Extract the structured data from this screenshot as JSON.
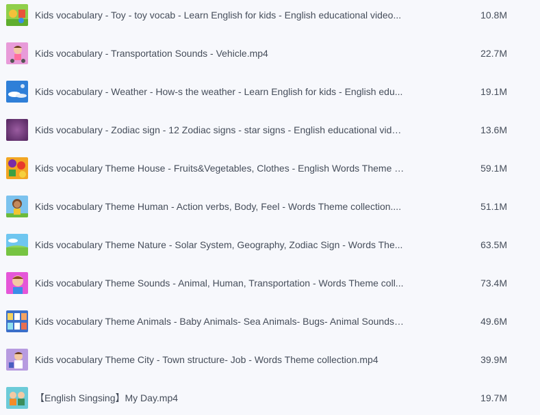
{
  "files": [
    {
      "name": "Kids vocabulary - Toy - toy vocab - Learn English for kids - English educational video...",
      "size": "10.8M",
      "thumb": "toy-thumbnail-icon"
    },
    {
      "name": "Kids vocabulary - Transportation Sounds - Vehicle.mp4",
      "size": "22.7M",
      "thumb": "transportation-thumbnail-icon"
    },
    {
      "name": "Kids vocabulary - Weather - How-s the weather - Learn English for kids - English edu...",
      "size": "19.1M",
      "thumb": "weather-thumbnail-icon"
    },
    {
      "name": "Kids vocabulary - Zodiac sign - 12 Zodiac signs - star signs - English educational vide...",
      "size": "13.6M",
      "thumb": "zodiac-thumbnail-icon"
    },
    {
      "name": "Kids vocabulary Theme House - Fruits&Vegetables, Clothes - English Words Theme c...",
      "size": "59.1M",
      "thumb": "house-thumbnail-icon"
    },
    {
      "name": "Kids vocabulary Theme Human - Action verbs, Body, Feel - Words Theme collection....",
      "size": "51.1M",
      "thumb": "human-thumbnail-icon"
    },
    {
      "name": "Kids vocabulary Theme Nature - Solar System, Geography, Zodiac Sign - Words The...",
      "size": "63.5M",
      "thumb": "nature-thumbnail-icon"
    },
    {
      "name": "Kids vocabulary Theme Sounds - Animal, Human, Transportation - Words Theme coll...",
      "size": "73.4M",
      "thumb": "sounds-thumbnail-icon"
    },
    {
      "name": "Kids vocabulary Theme Animals - Baby Animals- Sea Animals- Bugs- Animal Sounds ...",
      "size": "49.6M",
      "thumb": "animals-thumbnail-icon"
    },
    {
      "name": "Kids vocabulary Theme City - Town structure- Job - Words Theme collection.mp4",
      "size": "39.9M",
      "thumb": "city-thumbnail-icon"
    },
    {
      "name": "【English Singsing】My Day.mp4",
      "size": "19.7M",
      "thumb": "my-day-thumbnail-icon"
    }
  ],
  "colors": {
    "background": "#f7f8fc",
    "text": "#454d5a"
  }
}
